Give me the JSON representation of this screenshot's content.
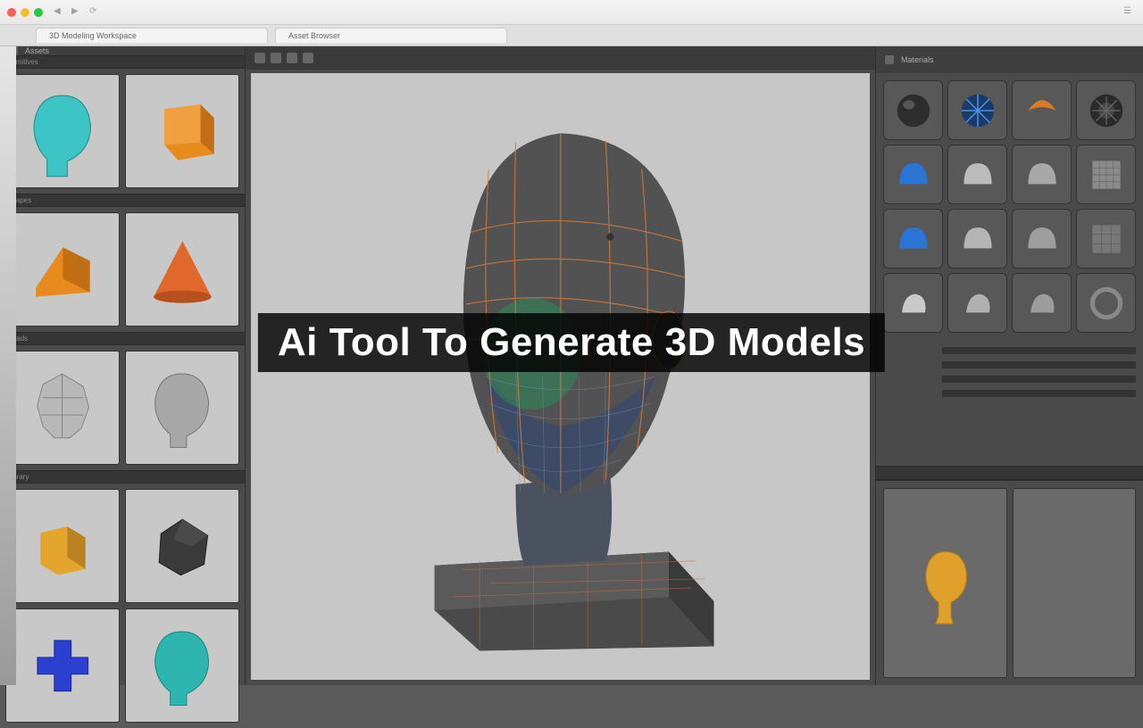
{
  "chrome": {
    "url_hint": "",
    "tabs": [
      "3D Modeling Workspace",
      "Asset Browser"
    ]
  },
  "overlay": {
    "title": "Ai Tool To Generate 3D Models"
  },
  "left_panel": {
    "header": "Assets",
    "sections": [
      "Primitives",
      "Shapes",
      "Heads",
      "Library"
    ],
    "assets": [
      {
        "name": "head-teal",
        "color": "#3dc4c4",
        "shape": "bust"
      },
      {
        "name": "cube-orange",
        "color": "#e78b1f",
        "shape": "cube"
      },
      {
        "name": "wedge-orange",
        "color": "#e78b1f",
        "shape": "wedge"
      },
      {
        "name": "cone-orange",
        "color": "#e0682c",
        "shape": "cone"
      },
      {
        "name": "lowpoly-head-gray",
        "color": "#b8b8b8",
        "shape": "lowpoly"
      },
      {
        "name": "head-gray",
        "color": "#a8a8a8",
        "shape": "bust"
      },
      {
        "name": "block-yellow",
        "color": "#e3a52e",
        "shape": "block"
      },
      {
        "name": "rock-dark",
        "color": "#3a3a3a",
        "shape": "rock"
      },
      {
        "name": "cross-blue",
        "color": "#2b3fd1",
        "shape": "cross"
      },
      {
        "name": "head-cyan",
        "color": "#2fb5b0",
        "shape": "bust"
      }
    ]
  },
  "right_panel": {
    "materials_label": "Materials",
    "materials": [
      {
        "name": "sphere-dark",
        "color": "#2d2d2d",
        "shape": "sphere"
      },
      {
        "name": "fan-blue",
        "color": "#2a6ad6",
        "shape": "fan"
      },
      {
        "name": "torus-orange",
        "color": "#d97a2a",
        "shape": "torus"
      },
      {
        "name": "wheel",
        "color": "#3a3a3a",
        "shape": "wheel"
      },
      {
        "name": "cap-blue-1",
        "color": "#2a75d6",
        "shape": "dome"
      },
      {
        "name": "cap-gray-1",
        "color": "#bcbcbc",
        "shape": "dome"
      },
      {
        "name": "cap-gray-2",
        "color": "#a8a8a8",
        "shape": "dome"
      },
      {
        "name": "mesh-gray",
        "color": "#8a8a8a",
        "shape": "mesh"
      },
      {
        "name": "cap-blue-2",
        "color": "#2a75d6",
        "shape": "dome"
      },
      {
        "name": "cap-gray-3",
        "color": "#b4b4b4",
        "shape": "dome"
      },
      {
        "name": "cap-gray-4",
        "color": "#9e9e9e",
        "shape": "dome"
      },
      {
        "name": "mesh-gray-2",
        "color": "#787878",
        "shape": "mesh"
      },
      {
        "name": "shell-1",
        "color": "#cacaca",
        "shape": "shell"
      },
      {
        "name": "shell-2",
        "color": "#b0b0b0",
        "shape": "shell"
      },
      {
        "name": "shell-3",
        "color": "#9c9c9c",
        "shape": "shell"
      },
      {
        "name": "ring",
        "color": "#888",
        "shape": "ring"
      }
    ],
    "lower": [
      {
        "name": "bust-orange",
        "color": "#e0a02c"
      },
      {
        "name": "preview-empty",
        "color": "#6a6a6a"
      }
    ]
  },
  "viewport": {
    "model_name": "head-wireframe-bust"
  }
}
